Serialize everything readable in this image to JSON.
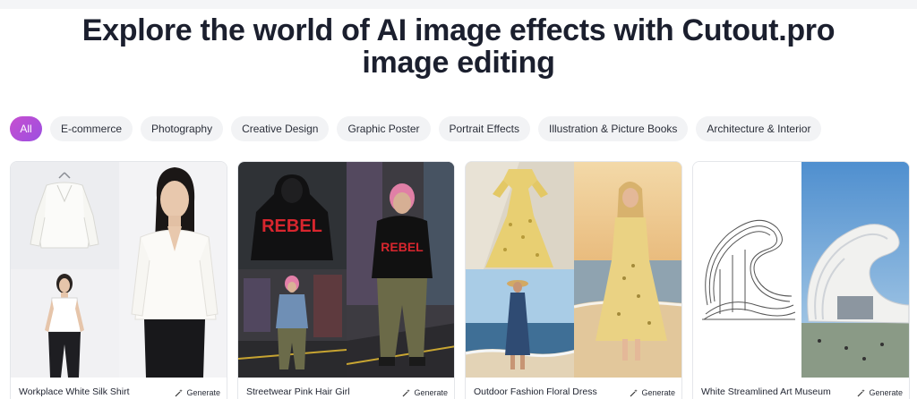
{
  "header": {
    "title": "Explore the world of AI image effects with Cutout.pro image editing"
  },
  "categories": [
    {
      "label": "All",
      "active": true
    },
    {
      "label": "E-commerce"
    },
    {
      "label": "Photography"
    },
    {
      "label": "Creative Design"
    },
    {
      "label": "Graphic Poster"
    },
    {
      "label": "Portrait Effects"
    },
    {
      "label": "Illustration & Picture Books"
    },
    {
      "label": "Architecture & Interior"
    }
  ],
  "cards": [
    {
      "title": "Workplace White Silk Shirt",
      "action": "Generate"
    },
    {
      "title": "Streetwear Pink Hair Girl",
      "action": "Generate"
    },
    {
      "title": "Outdoor Fashion Floral Dress",
      "action": "Generate"
    },
    {
      "title": "White Streamlined Art Museum",
      "action": "Generate"
    }
  ],
  "colors": {
    "accent_gradient_start": "#c74fd0",
    "accent_gradient_end": "#9b4fe0",
    "tab_bg": "#f2f3f5",
    "heading": "#1b1f2e"
  },
  "icons": {
    "generate": "magic-wand-icon"
  }
}
